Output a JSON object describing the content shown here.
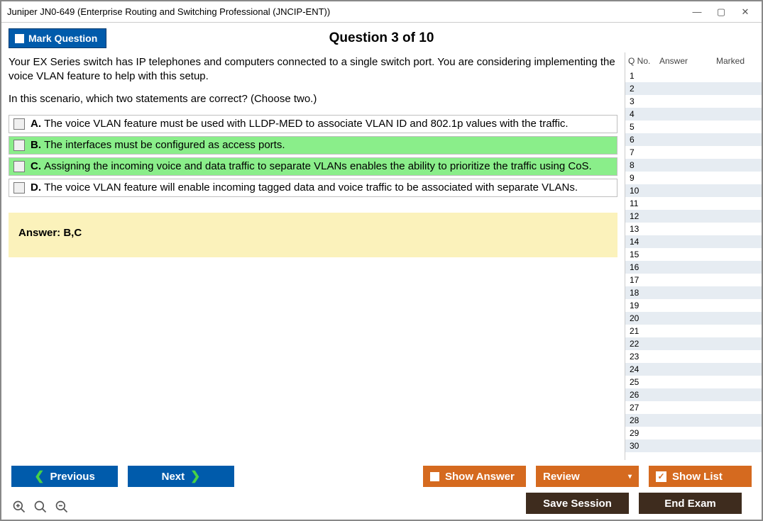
{
  "window_title": "Juniper JN0-649 (Enterprise Routing and Switching Professional (JNCIP-ENT))",
  "mark_label": "Mark Question",
  "question_pos": "Question 3 of 10",
  "question_text": "Your EX Series switch has IP telephones and computers connected to a single switch port. You are considering implementing the voice VLAN feature to help with this setup.",
  "question_text2": "In this scenario, which two statements are correct? (Choose two.)",
  "options": [
    {
      "letter": "A.",
      "text": "The voice VLAN feature must be used with LLDP-MED to associate VLAN ID and 802.1p values with the traffic.",
      "correct": false
    },
    {
      "letter": "B.",
      "text": "The interfaces must be configured as access ports.",
      "correct": true
    },
    {
      "letter": "C.",
      "text": "Assigning the incoming voice and data traffic to separate VLANs enables the ability to prioritize the traffic using CoS.",
      "correct": true
    },
    {
      "letter": "D.",
      "text": "The voice VLAN feature will enable incoming tagged data and voice traffic to be associated with separate VLANs.",
      "correct": false
    }
  ],
  "answer_label": "Answer: B,C",
  "side": {
    "h1": "Q No.",
    "h2": "Answer",
    "h3": "Marked",
    "rows": [
      1,
      2,
      3,
      4,
      5,
      6,
      7,
      8,
      9,
      10,
      11,
      12,
      13,
      14,
      15,
      16,
      17,
      18,
      19,
      20,
      21,
      22,
      23,
      24,
      25,
      26,
      27,
      28,
      29,
      30
    ]
  },
  "buttons": {
    "prev": "Previous",
    "next": "Next",
    "show_answer": "Show Answer",
    "review": "Review",
    "show_list": "Show List",
    "save_session": "Save Session",
    "end_exam": "End Exam"
  }
}
